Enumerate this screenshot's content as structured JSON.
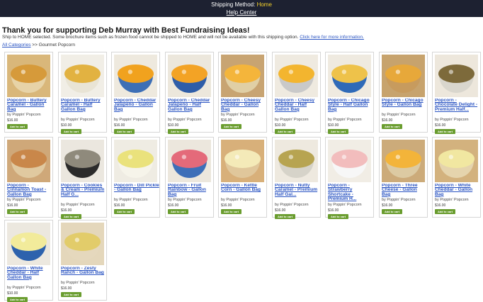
{
  "topbar": {
    "shipping_label": "Shipping Method:",
    "shipping_value": "Home",
    "help_center": "Help Center"
  },
  "heading": "Thank you for supporting Deb Murray with Best Fundraising Ideas!",
  "subline": {
    "text": "Ship to HOME selected. Some brochure items such as frozen food cannot be shipped to HOME and will not be available with this shipping option.",
    "link": "Click here for more information."
  },
  "breadcrumb": {
    "all_categories": "All Categories",
    "separator": ">>",
    "current": "Gourmet Popcorn"
  },
  "colors": {
    "accent_link": "#2a54c2",
    "add_to_cart": "#6a9d2f",
    "topbar": "#1d2131",
    "highlight": "#f6d32b"
  },
  "add_to_cart_label": "Add to cart",
  "products": [
    {
      "name": "Popcorn - Buttery Caramel - Gallon Bag",
      "vendor": "by Poppin' Popcorn",
      "price": "$16.00",
      "bg": "#d9b77a",
      "pop": "#d69a3a",
      "bowl": "#e7d3a7"
    },
    {
      "name": "Popcorn - Buttery Caramel - Half Gallon Bag",
      "vendor": "by Poppin' Popcorn",
      "price": "$10.00",
      "bg": "#f1eee6",
      "pop": "#e2b241",
      "bowl": "#e9e4d5"
    },
    {
      "name": "Popcorn - Cheddar Jalapeno - Gallon Bag",
      "vendor": "by Poppin' Popcorn",
      "price": "$16.00",
      "bg": "#eee9de",
      "pop": "#f1a21e",
      "bowl": "#3d6fb6"
    },
    {
      "name": "Popcorn - Cheddar Jalapeno - Half Gallon Bag",
      "vendor": "by Poppin' Popcorn",
      "price": "$10.00",
      "bg": "#ece7dc",
      "pop": "#f3a325",
      "bowl": "#2e5da8"
    },
    {
      "name": "Popcorn - Cheesy Cheddar - Gallon Bag",
      "vendor": "by Poppin' Popcorn",
      "price": "$16.00",
      "bg": "#c8a472",
      "pop": "#f4b53b",
      "bowl": "#e0cfa5"
    },
    {
      "name": "Popcorn - Cheesy Cheddar - Half Gallon Bag",
      "vendor": "by Poppin' Popcorn",
      "price": "$10.00",
      "bg": "#efeae0",
      "pop": "#f3b52f",
      "bowl": "#c9c9c9"
    },
    {
      "name": "Popcorn - Chicago Style - Half Gallon Bag",
      "vendor": "by Poppin' Popcorn",
      "price": "$10.00",
      "bg": "#efeae0",
      "pop": "#eec24a",
      "bowl": "#2f6ab8"
    },
    {
      "name": "Popcorn - Chicago Style - Gallon Bag",
      "vendor": "by Poppin' Popcorn",
      "price": "$16.00",
      "bg": "#c7a36d",
      "pop": "#e7a83a",
      "bowl": "#c79b5e"
    },
    {
      "name": "Popcorn - Chocolate Delight - Premium Half...",
      "vendor": "by Poppin' Popcorn",
      "price": "$16.00",
      "bg": "#ede7dc",
      "pop": "#7d6a3b",
      "bowl": "#d9d6cd"
    },
    {
      "name": "Popcorn - Cinnamon Toast - Gallon Bag",
      "vendor": "by Poppin' Popcorn",
      "price": "$16.00",
      "bg": "#cfa879",
      "pop": "#c9874a",
      "bowl": "#e0c9a0"
    },
    {
      "name": "Popcorn - Cookies & Cream - Premium Half G...",
      "vendor": "by Poppin' Popcorn",
      "price": "$16.00",
      "bg": "#ebe7df",
      "pop": "#8f8a7c",
      "bowl": "#2b2b2b"
    },
    {
      "name": "Popcorn - Dill Pickle - Gallon Bag",
      "vendor": "by Poppin' Popcorn",
      "price": "$16.00",
      "bg": "#efece3",
      "pop": "#eae27c",
      "bowl": "#f6f4ea"
    },
    {
      "name": "Popcorn - Fruit Rainbow - Gallon Bag",
      "vendor": "by Poppin' Popcorn",
      "price": "$16.00",
      "bg": "#ece7dd",
      "pop": "#e46a7a",
      "bowl": "#3e6fb8"
    },
    {
      "name": "Popcorn - Kettle Corn - Gallon Bag",
      "vendor": "by Poppin' Popcorn",
      "price": "$16.00",
      "bg": "#d8b07a",
      "pop": "#f4eab8",
      "bowl": "#e0c79b"
    },
    {
      "name": "Popcorn - Nutty Caramel - Premium Half Gal...",
      "vendor": "by Poppin' Popcorn",
      "price": "$16.00",
      "bg": "#eee9df",
      "pop": "#b7a451",
      "bowl": "#d6d3c9"
    },
    {
      "name": "Popcorn - Strawberry Shortcake - Premium H...",
      "vendor": "by Poppin' Popcorn",
      "price": "$16.00",
      "bg": "#f1ede5",
      "pop": "#f2bdbd",
      "bowl": "#f7f7f7"
    },
    {
      "name": "Popcorn - Three Cheese - Gallon Bag",
      "vendor": "by Poppin' Popcorn",
      "price": "$16.00",
      "bg": "#ccab7a",
      "pop": "#f3b43a",
      "bowl": "#dccaa2"
    },
    {
      "name": "Popcorn - White Cheddar - Gallon Bag",
      "vendor": "by Poppin' Popcorn",
      "price": "$16.00",
      "bg": "#d3b27e",
      "pop": "#f1e7a1",
      "bowl": "#e5d4ad"
    },
    {
      "name": "Popcorn - White Cheddar - Half Gallon Bag",
      "vendor": "by Poppin' Popcorn",
      "price": "$10.00",
      "bg": "#ece8df",
      "pop": "#f2eb9b",
      "bowl": "#2d62ad"
    },
    {
      "name": "Popcorn - Zesty Ranch - Gallon Bag",
      "vendor": "by Poppin' Popcorn",
      "price": "$16.00",
      "bg": "#e4d7bb",
      "pop": "#e2cc6a",
      "bowl": "#e5d8bd"
    }
  ]
}
